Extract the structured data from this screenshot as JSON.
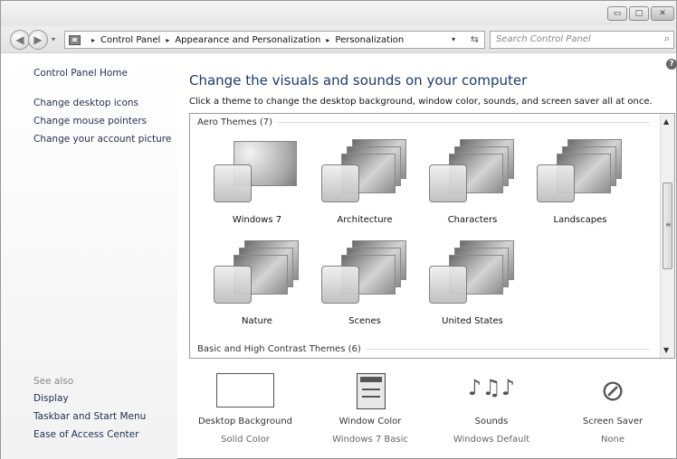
{
  "window": {
    "minimize_glyph": "▭",
    "maximize_glyph": "□",
    "close_glyph": "✕"
  },
  "address_bar": {
    "crumbs": [
      "Control Panel",
      "Appearance and Personalization",
      "Personalization"
    ],
    "separator": "▸",
    "dropdown": "▾",
    "refresh": "⇆"
  },
  "search": {
    "placeholder": "Search Control Panel",
    "icon": "⌕"
  },
  "left_pane": {
    "home": "Control Panel Home",
    "tasks": [
      "Change desktop icons",
      "Change mouse pointers",
      "Change your account picture"
    ],
    "see_also_label": "See also",
    "see_also": [
      "Display",
      "Taskbar and Start Menu",
      "Ease of Access Center"
    ]
  },
  "main": {
    "help": "?",
    "title": "Change the visuals and sounds on your computer",
    "subtitle": "Click a theme to change the desktop background, window color, sounds, and screen saver all at once."
  },
  "theme_groups": {
    "aero_label": "Aero Themes (7)",
    "aero_themes": [
      "Windows 7",
      "Architecture",
      "Characters",
      "Landscapes",
      "Nature",
      "Scenes",
      "United States"
    ],
    "basic_label": "Basic and High Contrast Themes (6)"
  },
  "scrollbar": {
    "up": "▲",
    "down": "▼",
    "grip": "≡"
  },
  "customizations": [
    {
      "title": "Desktop Background",
      "value": "Solid Color",
      "icon": "desktop-background-icon"
    },
    {
      "title": "Window Color",
      "value": "Windows 7 Basic",
      "icon": "window-color-icon"
    },
    {
      "title": "Sounds",
      "value": "Windows Default",
      "icon": "sounds-icon"
    },
    {
      "title": "Screen Saver",
      "value": "None",
      "icon": "screen-saver-icon"
    }
  ],
  "customization_glyphs": {
    "sounds": "♪♫♪",
    "screen_saver": "⊘"
  }
}
